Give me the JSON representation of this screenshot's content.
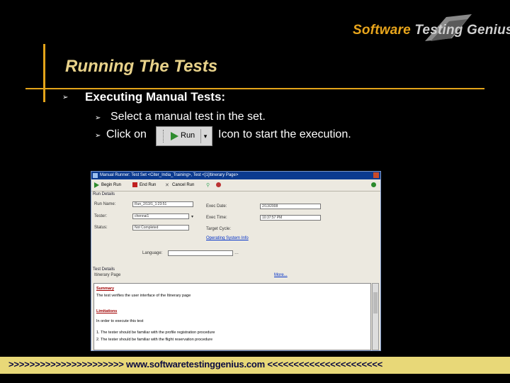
{
  "logo": {
    "word1": "Software",
    "word2": "Testing Genius"
  },
  "slide": {
    "title": "Running The Tests",
    "bullet_main": "Executing Manual Tests:",
    "sub1": "Select a manual test in the set.",
    "sub2_before": "Click on",
    "sub2_after": "Icon to start the execution."
  },
  "run_button": {
    "label": "Run"
  },
  "window": {
    "title": "Manual Runner: Test Set <Citer_India_Training>, Test <[1]Itinerary Page>",
    "toolbar": {
      "begin_run": "Begin Run",
      "end_run": "End Run",
      "cancel_run": "Cancel Run"
    },
    "run_details_label": "Run Details",
    "fields": {
      "run_name_label": "Run Name:",
      "run_name_value": "Run_2/13/1_1:23:51",
      "tester_label": "Tester:",
      "tester_value": "chennai1",
      "status_label": "Status:",
      "status_value": "Not Completed",
      "exec_date_label": "Exec Date:",
      "exec_date_value": "2/13/2008",
      "exec_time_label": "Exec Time:",
      "exec_time_value": "10:37:57 PM",
      "target_cycle_label": "Target Cycle:",
      "operating_system_link": "Operating System Info",
      "language_label": "Language:"
    },
    "test_details_label": "Test Details",
    "test_name": "Itinerary Page",
    "more_link": "More...",
    "desc": {
      "summary_head": "Summary",
      "summary_text": "The test verifies the user interface of the Itinerary page",
      "limitations_head": "Limitations",
      "limit_intro": "In order to execute this test",
      "limit_1": "1. The tester should be familiar with the profile registration procedure",
      "limit_2": "2. The tester should be familiar with the flight reservation procedure"
    }
  },
  "footer": {
    "text": ">>>>>>>>>>>>>>>>>>>>>> www.softwaretestinggenius.com <<<<<<<<<<<<<<<<<<<<<<"
  }
}
